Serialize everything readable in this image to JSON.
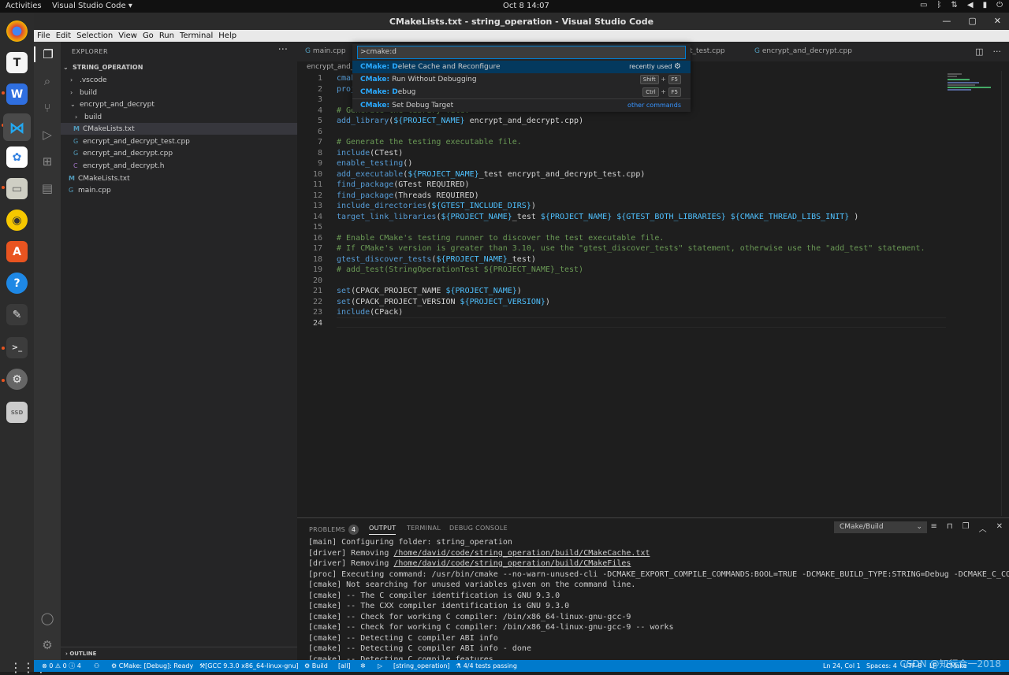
{
  "system": {
    "activities": "Activities",
    "app_name": "Visual Studio Code ▾",
    "clock": "Oct 8  14:07"
  },
  "window": {
    "title": "CMakeLists.txt - string_operation - Visual Studio Code"
  },
  "menu": [
    "File",
    "Edit",
    "Selection",
    "View",
    "Go",
    "Run",
    "Terminal",
    "Help"
  ],
  "explorer": {
    "header": "EXPLORER",
    "project": "STRING_OPERATION",
    "items": [
      {
        "label": ".vscode",
        "icon": "chevron-right"
      },
      {
        "label": "build",
        "icon": "chevron-right"
      },
      {
        "label": "encrypt_and_decrypt",
        "icon": "chevron-down"
      },
      {
        "label": "build",
        "icon": "chevron-right"
      },
      {
        "label": "CMakeLists.txt",
        "icon": "M"
      },
      {
        "label": "encrypt_and_decrypt_test.cpp",
        "icon": "G"
      },
      {
        "label": "encrypt_and_decrypt.cpp",
        "icon": "G"
      },
      {
        "label": "encrypt_and_decrypt.h",
        "icon": "C"
      },
      {
        "label": "CMakeLists.txt",
        "icon": "M"
      },
      {
        "label": "main.cpp",
        "icon": "G"
      }
    ],
    "outline": "OUTLINE"
  },
  "tabs": [
    "main.cpp",
    "t_test.cpp",
    "encrypt_and_decrypt.cpp"
  ],
  "breadcrumb": "encrypt_and_d",
  "palette": {
    "input": ">cmake:d",
    "items": [
      {
        "prefix": "CMake: ",
        "hl": "D",
        "rest": "elete Cache and Reconfigure",
        "right": "recently used"
      },
      {
        "prefix": "CMake: ",
        "hl": "",
        "rest": "Run Without Debugging",
        "key1": "Shift",
        "key2": "F5"
      },
      {
        "prefix": "CMake: ",
        "hl": "D",
        "rest": "ebug",
        "key1": "Ctrl",
        "key2": "F5"
      },
      {
        "prefix": "CMake: ",
        "hl": "",
        "rest": "Set Debug Target",
        "right": "other commands"
      }
    ]
  },
  "code_lines": [
    "cmake_minimum_required(VERSION 3.10)",
    "project(string_operation)",
    "",
    "# Generate the library file.",
    "add_library(${PROJECT_NAME} encrypt_and_decrypt.cpp)",
    "",
    "# Generate the testing executable file.",
    "include(CTest)",
    "enable_testing()",
    "add_executable(${PROJECT_NAME}_test encrypt_and_decrypt_test.cpp)",
    "find_package(GTest REQUIRED)",
    "find_package(Threads REQUIRED)",
    "include_directories(${GTEST_INCLUDE_DIRS})",
    "target_link_libraries(${PROJECT_NAME}_test ${PROJECT_NAME} ${GTEST_BOTH_LIBRARIES} ${CMAKE_THREAD_LIBS_INIT} )",
    "",
    "# Enable CMake's testing runner to discover the test executable file.",
    "# If CMake's version is greater than 3.10, use the \"gtest_discover_tests\" statement, otherwise use the \"add_test\" statement.",
    "gtest_discover_tests(${PROJECT_NAME}_test)",
    "# add_test(StringOperationTest ${PROJECT_NAME}_test)",
    "",
    "set(CPACK_PROJECT_NAME ${PROJECT_NAME})",
    "set(CPACK_PROJECT_VERSION ${PROJECT_VERSION})",
    "include(CPack)",
    ""
  ],
  "panel": {
    "tabs": {
      "problems": "PROBLEMS",
      "problems_count": "4",
      "output": "OUTPUT",
      "terminal": "TERMINAL",
      "debug": "DEBUG CONSOLE"
    },
    "channel": "CMake/Build",
    "output_lines": [
      "[main] Configuring folder: string_operation",
      "[driver] Removing /home/david/code/string_operation/build/CMakeCache.txt",
      "[driver] Removing /home/david/code/string_operation/build/CMakeFiles",
      "[proc] Executing command: /usr/bin/cmake --no-warn-unused-cli -DCMAKE_EXPORT_COMPILE_COMMANDS:BOOL=TRUE -DCMAKE_BUILD_TYPE:STRING=Debug -DCMAKE_C_COM",
      "[cmake] Not searching for unused variables given on the command line.",
      "[cmake] -- The C compiler identification is GNU 9.3.0",
      "[cmake] -- The CXX compiler identification is GNU 9.3.0",
      "[cmake] -- Check for working C compiler: /bin/x86_64-linux-gnu-gcc-9",
      "[cmake] -- Check for working C compiler: /bin/x86_64-linux-gnu-gcc-9 -- works",
      "[cmake] -- Detecting C compiler ABI info",
      "[cmake] -- Detecting C compiler ABI info - done",
      "[cmake] -- Detecting C compile features"
    ]
  },
  "status": {
    "problems": "⊗ 0 ⚠ 0 ⓘ 4",
    "cmake_status": "CMake: [Debug]: Ready",
    "kit": "[GCC 9.3.0 x86_64-linux-gnu]",
    "build": "Build",
    "target": "[all]",
    "launch_target": "[string_operation]",
    "tests": "4/4 tests passing",
    "position": "Ln 24, Col 1",
    "spaces": "Spaces: 4",
    "encoding": "UTF-8",
    "eol": "LF",
    "lang": "CMake"
  },
  "watermark": "CSDN @知行合一2018",
  "colors": {
    "accent": "#007acc",
    "selection": "#04395e",
    "highlight": "#2aaaff"
  }
}
